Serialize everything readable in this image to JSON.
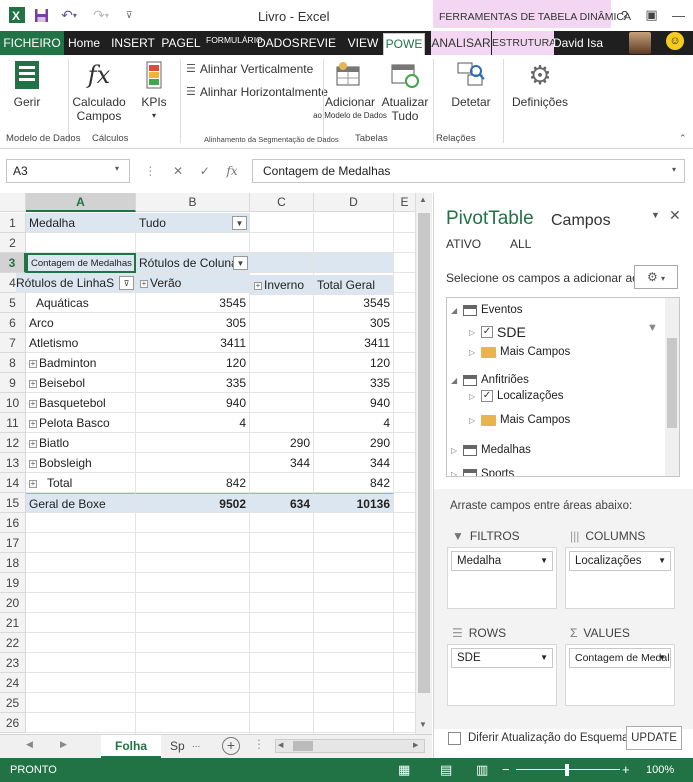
{
  "window": {
    "title": "Livro - Excel",
    "tooltab_title": "FERRAMENTAS DE TABELA DINÂMICA",
    "user": "David Isa",
    "smiley": "☺"
  },
  "tabs": [
    {
      "label": "FICHEIRO"
    },
    {
      "label": "Home"
    },
    {
      "label": "INSERT"
    },
    {
      "label": "PAGEL"
    },
    {
      "label": "FORMULÁRIO"
    },
    {
      "label": "DADOS"
    },
    {
      "label": "REVIE"
    },
    {
      "label": "VIEW"
    },
    {
      "label": "POWE"
    },
    {
      "label": "ANALISAR"
    },
    {
      "label": "ESTRUTURA"
    }
  ],
  "ribbon": {
    "gerir": "Gerir",
    "calculado": "Calculado",
    "campos": "Campos",
    "kpis": "KPIs",
    "alinhar_v": "Alinhar Verticalmente",
    "alinhar_h": "Alinhar Horizontalmente",
    "adicionar": "Adicionar",
    "ao_modelo": "ao Modelo de Dados",
    "atualizar": "Atualizar",
    "tudo": "Tudo",
    "detetar": "Detetar",
    "definicoes": "Definições",
    "grp_modelo": "Modelo de Dados",
    "grp_calculos": "Cálculos",
    "grp_alinhamento": "Alinhamento da Segmentação de Dados",
    "grp_tabelas": "Tabelas",
    "grp_relacoes": "Relações"
  },
  "formula_bar": {
    "namebox": "A3",
    "formula": "Contagem de Medalhas"
  },
  "sheet": {
    "columns": [
      "A",
      "B",
      "C",
      "D",
      "E"
    ],
    "rows": [
      "1",
      "2",
      "3",
      "4",
      "5",
      "6",
      "7",
      "8",
      "9",
      "10",
      "11",
      "12",
      "13",
      "14",
      "15",
      "16",
      "17",
      "18",
      "19",
      "20",
      "21",
      "22",
      "23",
      "24",
      "25",
      "26"
    ],
    "r1": {
      "a": "Medalha",
      "b": "Tudo"
    },
    "r3": {
      "a": "Contagem de Medalhas",
      "b": "Rótulos de Coluna"
    },
    "r4": {
      "a": "Rótulos de LinhaS",
      "b": "Verão",
      "c": "Inverno",
      "d": "Total Geral"
    },
    "data_rows": [
      {
        "label": "Aquáticas",
        "verao": "3545",
        "inverno": "",
        "total": "3545",
        "plus": false
      },
      {
        "label": "Arco",
        "verao": "305",
        "inverno": "",
        "total": "305",
        "plus": false
      },
      {
        "label": "Atletismo",
        "verao": "3411",
        "inverno": "",
        "total": "3411",
        "plus": false
      },
      {
        "label": "Badminton",
        "verao": "120",
        "inverno": "",
        "total": "120",
        "plus": true
      },
      {
        "label": "Beisebol",
        "verao": "335",
        "inverno": "",
        "total": "335",
        "plus": true
      },
      {
        "label": "Basquetebol",
        "verao": "940",
        "inverno": "",
        "total": "940",
        "plus": true
      },
      {
        "label": "Pelota Basco",
        "verao": "4",
        "inverno": "",
        "total": "4",
        "plus": true
      },
      {
        "label": "Biatlo",
        "verao": "",
        "inverno": "290",
        "total": "290",
        "plus": true
      },
      {
        "label": "Bobsleigh",
        "verao": "",
        "inverno": "344",
        "total": "344",
        "plus": true
      },
      {
        "label": "Total",
        "verao": "842",
        "inverno": "",
        "total": "842",
        "plus": true
      }
    ],
    "grand": {
      "label": "Geral de Boxe",
      "verao": "9502",
      "inverno": "634",
      "total": "10136"
    },
    "tabs": {
      "folha": "Folha",
      "sp": "Sp"
    }
  },
  "pane": {
    "title_a": "PivotTable",
    "title_b": "Campos",
    "tab_ativo": "ATIVO",
    "tab_all": "ALL",
    "instruction": "Selecione os campos a adicionar ao relatório:",
    "fields": {
      "eventos": "Eventos",
      "sde": "SDE",
      "mais1": "Mais Campos",
      "anfitrioes": "Anfitriões",
      "localizacoes": "Localizações",
      "mais2": "Mais Campos",
      "medalhas": "Medalhas",
      "sports": "Sports"
    },
    "drag_label": "Arraste campos entre áreas abaixo:",
    "filtros": "FILTROS",
    "columns": "COLUMNS",
    "rows": "ROWS",
    "values": "VALUES",
    "filtros_val": "Medalha",
    "columns_val": "Localizações",
    "rows_val": "SDE",
    "values_val": "Contagem de Medalhas",
    "defer": "Diferir Atualização do Esquema",
    "update": "UPDATE"
  },
  "status": {
    "ready": "PRONTO",
    "zoom": "100%"
  }
}
